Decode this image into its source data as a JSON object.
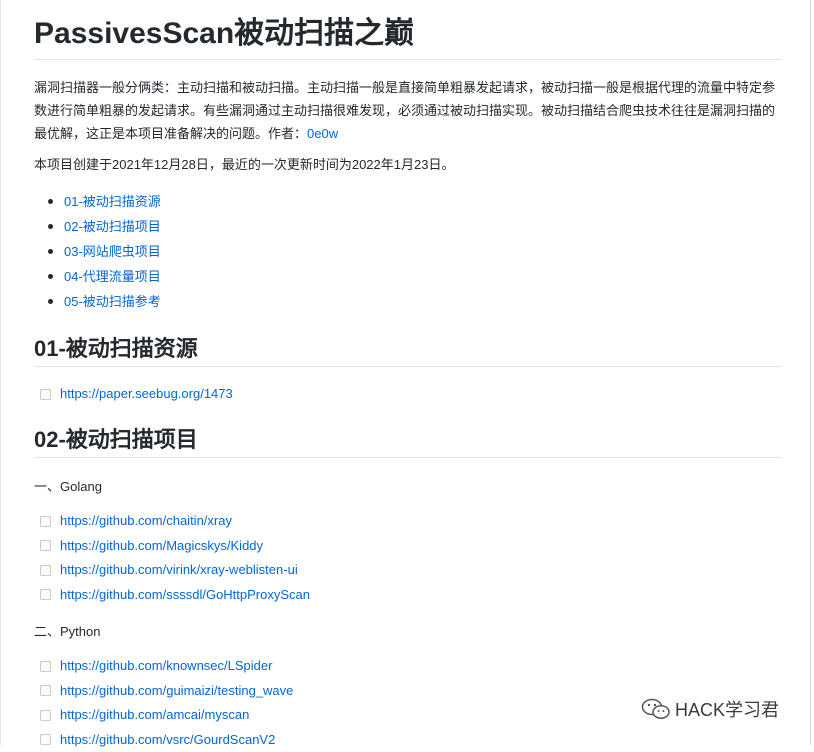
{
  "page_title": "PassivesScan被动扫描之巅",
  "intro": {
    "text": "漏洞扫描器一般分俩类：主动扫描和被动扫描。主动扫描一般是直接简单粗暴发起请求，被动扫描一般是根据代理的流量中特定参数进行简单粗暴的发起请求。有些漏洞通过主动扫描很难发现，必须通过被动扫描实现。被动扫描结合爬虫技术往往是漏洞扫描的最优解，这正是本项目准备解决的问题。作者：",
    "author": "0e0w"
  },
  "dates": "本项目创建于2021年12月28日，最近的一次更新时间为2022年1月23日。",
  "toc": [
    "01-被动扫描资源",
    "02-被动扫描项目",
    "03-网站爬虫项目",
    "04-代理流量项目",
    "05-被动扫描参考"
  ],
  "section1": {
    "heading": "01-被动扫描资源",
    "links": [
      "https://paper.seebug.org/1473"
    ]
  },
  "section2": {
    "heading": "02-被动扫描项目",
    "golang_label": "一、Golang",
    "golang_links": [
      "https://github.com/chaitin/xray",
      "https://github.com/Magicskys/Kiddy",
      "https://github.com/virink/xray-weblisten-ui",
      "https://github.com/ssssdl/GoHttpProxyScan"
    ],
    "python_label": "二、Python",
    "python_links": [
      "https://github.com/knownsec/LSpider",
      "https://github.com/guimaizi/testing_wave",
      "https://github.com/amcai/myscan",
      "https://github.com/vsrc/GourdScanV2"
    ]
  },
  "watermark": "HACK学习君"
}
